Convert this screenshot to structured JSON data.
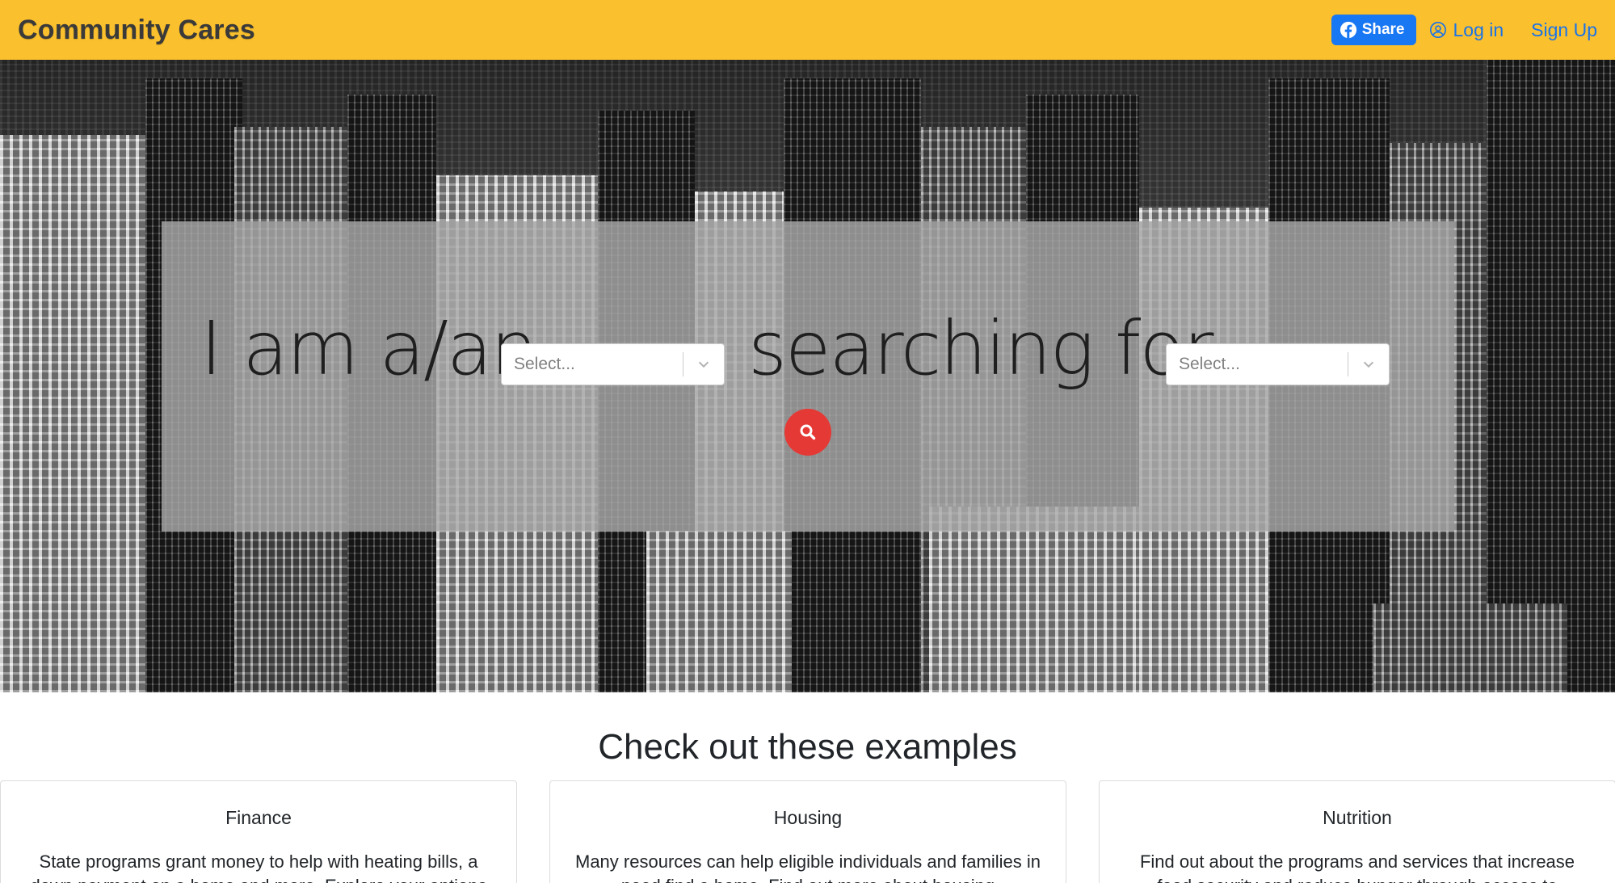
{
  "brand": "Community Cares",
  "nav": {
    "share_label": "Share",
    "login_label": "Log in",
    "signup_label": "Sign Up"
  },
  "search": {
    "lead_one": "I am a/an",
    "lead_two": "searching for",
    "select_one_placeholder": "Select...",
    "select_two_placeholder": "Select..."
  },
  "examples": {
    "heading": "Check out these examples",
    "cards": [
      {
        "title": "Finance",
        "text": "State programs grant money to help with heating bills, a down payment on a home and more. Explore your options"
      },
      {
        "title": "Housing",
        "text": "Many resources can help eligible individuals and families in need find a home. Find out more about housing"
      },
      {
        "title": "Nutrition",
        "text": "Find out about the programs and services that increase food security and reduce hunger through access to"
      }
    ]
  },
  "colors": {
    "navbar": "#fbc02d",
    "link": "#1a73e8",
    "facebook": "#1877f2",
    "search_button": "#e53935"
  }
}
